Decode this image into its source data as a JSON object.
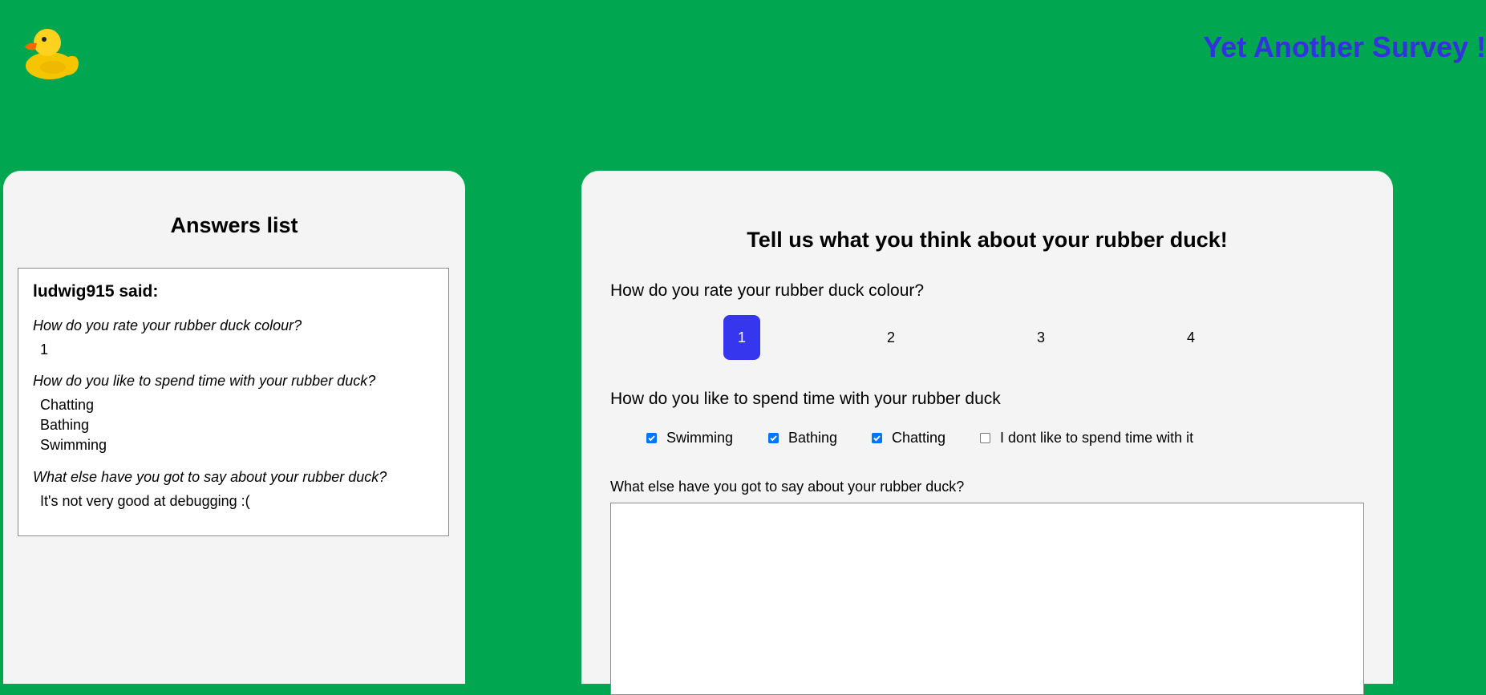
{
  "header": {
    "logo_icon": "rubber-duck-icon",
    "title": "Yet Another Survey !"
  },
  "colors": {
    "page_background": "#00a650",
    "title": "#3333dd",
    "selected_rating": "#3636ee",
    "panel": "#f4f4f4"
  },
  "answers": {
    "heading": "Answers list",
    "card": {
      "author": "ludwig915 said:",
      "q1": "How do you rate your rubber duck colour?",
      "q1_answer": "1",
      "q2": "How do you like to spend time with your rubber duck?",
      "q2_answers": [
        "Chatting",
        "Bathing",
        "Swimming"
      ],
      "q3": "What else have you got to say about your rubber duck?",
      "q3_answer": "It's not very good at debugging :("
    }
  },
  "survey": {
    "heading": "Tell us what you think about your rubber duck!",
    "rating_question": "How do you rate your rubber duck colour?",
    "rating_options": [
      "1",
      "2",
      "3",
      "4"
    ],
    "rating_selected": "1",
    "time_question": "How do you like to spend time with your rubber duck",
    "time_options": [
      {
        "label": "Swimming",
        "checked": true
      },
      {
        "label": "Bathing",
        "checked": true
      },
      {
        "label": "Chatting",
        "checked": true
      },
      {
        "label": "I dont like to spend time with it",
        "checked": false
      }
    ],
    "comment_label": "What else have you got to say about your rubber duck?",
    "comment_value": ""
  }
}
